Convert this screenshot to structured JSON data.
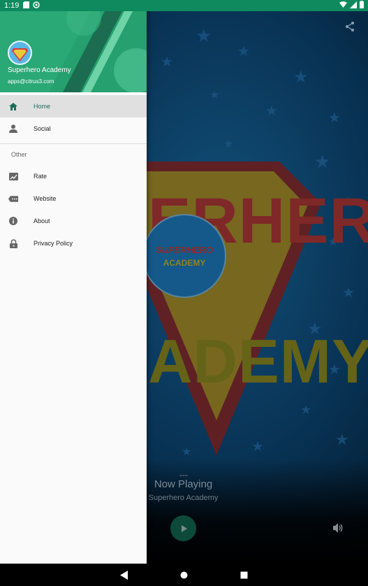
{
  "status_bar": {
    "time": "1:19"
  },
  "drawer": {
    "app_name": "Superhero Academy",
    "email": "apps@citrus3.com",
    "avatar_text": "SUPERHERO ACADEMY",
    "primary_items": [
      {
        "label": "Home",
        "icon": "home-icon",
        "active": true
      },
      {
        "label": "Social",
        "icon": "person-icon",
        "active": false
      }
    ],
    "section_title": "Other",
    "secondary_items": [
      {
        "label": "Rate",
        "icon": "rate-icon"
      },
      {
        "label": "Website",
        "icon": "website-icon"
      },
      {
        "label": "About",
        "icon": "info-icon"
      },
      {
        "label": "Privacy Policy",
        "icon": "lock-icon"
      }
    ]
  },
  "player": {
    "logo_big_text_top": "ERHERO",
    "logo_big_text_bottom": "ADEMY",
    "logo_small_text_top": "SUPERHERO",
    "logo_small_text_bottom": "ACADEMY",
    "dash": "---",
    "now_playing_label": "Now Playing",
    "station_name": "Superhero Academy"
  },
  "colors": {
    "accent": "#1a6e58",
    "header_green": "#1f9a6c",
    "status_bar": "#0f8a5f",
    "play_button": "#0e4a3a"
  }
}
